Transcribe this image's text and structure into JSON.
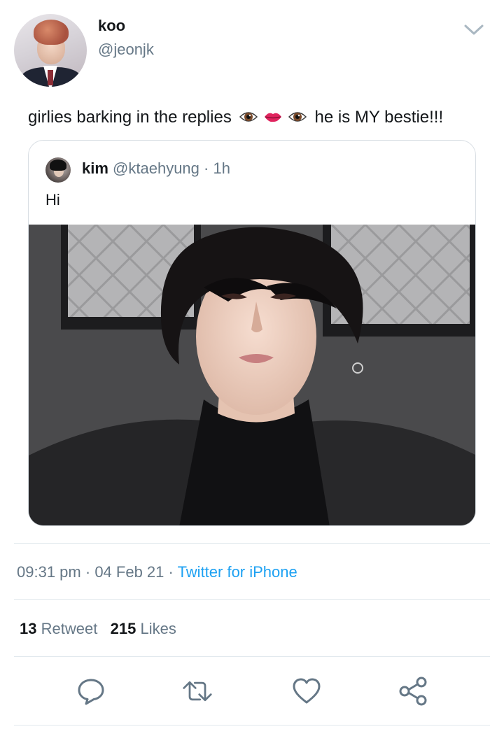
{
  "author": {
    "display_name": "koo",
    "handle": "@jeonjk"
  },
  "tweet": {
    "text_before": "girlies barking in the replies",
    "emojis": [
      "eye",
      "lips",
      "eye"
    ],
    "text_after": "he is MY bestie!!!"
  },
  "quoted": {
    "display_name": "kim",
    "handle": "@ktaehyung",
    "separator": "·",
    "time": "1h",
    "text": "Hi"
  },
  "meta": {
    "time": "09:31 pm",
    "sep1": "·",
    "date": "04 Feb 21",
    "sep2": "·",
    "source": "Twitter for iPhone"
  },
  "stats": {
    "retweets_count": "13",
    "retweets_label": "Retweet",
    "likes_count": "215",
    "likes_label": "Likes"
  },
  "actions": [
    "reply-icon",
    "retweet-icon",
    "like-icon",
    "share-icon"
  ],
  "colors": {
    "text_primary": "#14171a",
    "text_secondary": "#657786",
    "accent": "#1da1f2",
    "divider": "#e1e8ed",
    "icon": "#657786"
  }
}
